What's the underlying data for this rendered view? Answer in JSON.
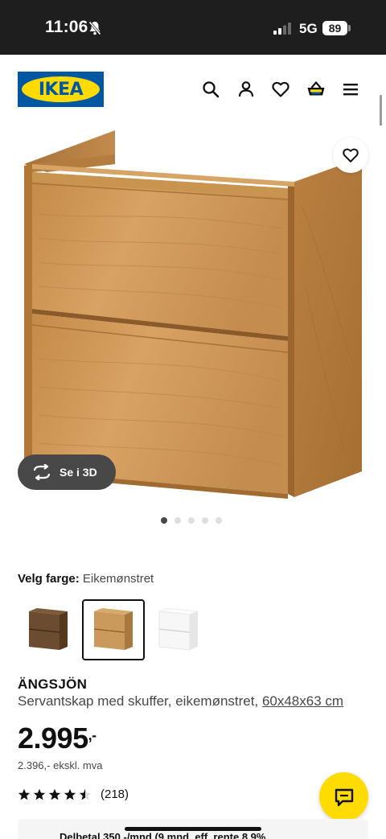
{
  "status_bar": {
    "time": "11:06",
    "network": "5G",
    "battery": "89"
  },
  "header": {
    "logo_text": "IKEA",
    "icons": [
      "search-icon",
      "user-icon",
      "heart-icon",
      "basket-icon",
      "menu-icon"
    ]
  },
  "gallery": {
    "view_3d_label": "Se i 3D",
    "image_count": 5,
    "active_index": 0
  },
  "color_picker": {
    "label": "Velg farge:",
    "selected": "Eikemønstret",
    "swatches": [
      {
        "name": "brown",
        "color": "#6b4c31",
        "selected": false
      },
      {
        "name": "oak",
        "color": "#c99a5b",
        "selected": true
      },
      {
        "name": "white",
        "color": "#f4f4f4",
        "selected": false
      }
    ]
  },
  "product": {
    "brand": "ÄNGSJÖN",
    "description": "Servantskap med skuffer, eikemønstret,",
    "dimensions": "60x48x63 cm",
    "price": "2.995",
    "price_suffix": ",-",
    "price_ex_vat": "2.396,- ekskl. mva",
    "rating": 4.5,
    "rating_count": "(218)"
  },
  "finance": {
    "text": "Delbetal 350,-/mnd (9 mnd, eff. rente 8,9%"
  },
  "colors": {
    "ikea_blue": "#0058a3",
    "ikea_yellow": "#ffdb00",
    "status_bg": "#1e1e1e"
  }
}
